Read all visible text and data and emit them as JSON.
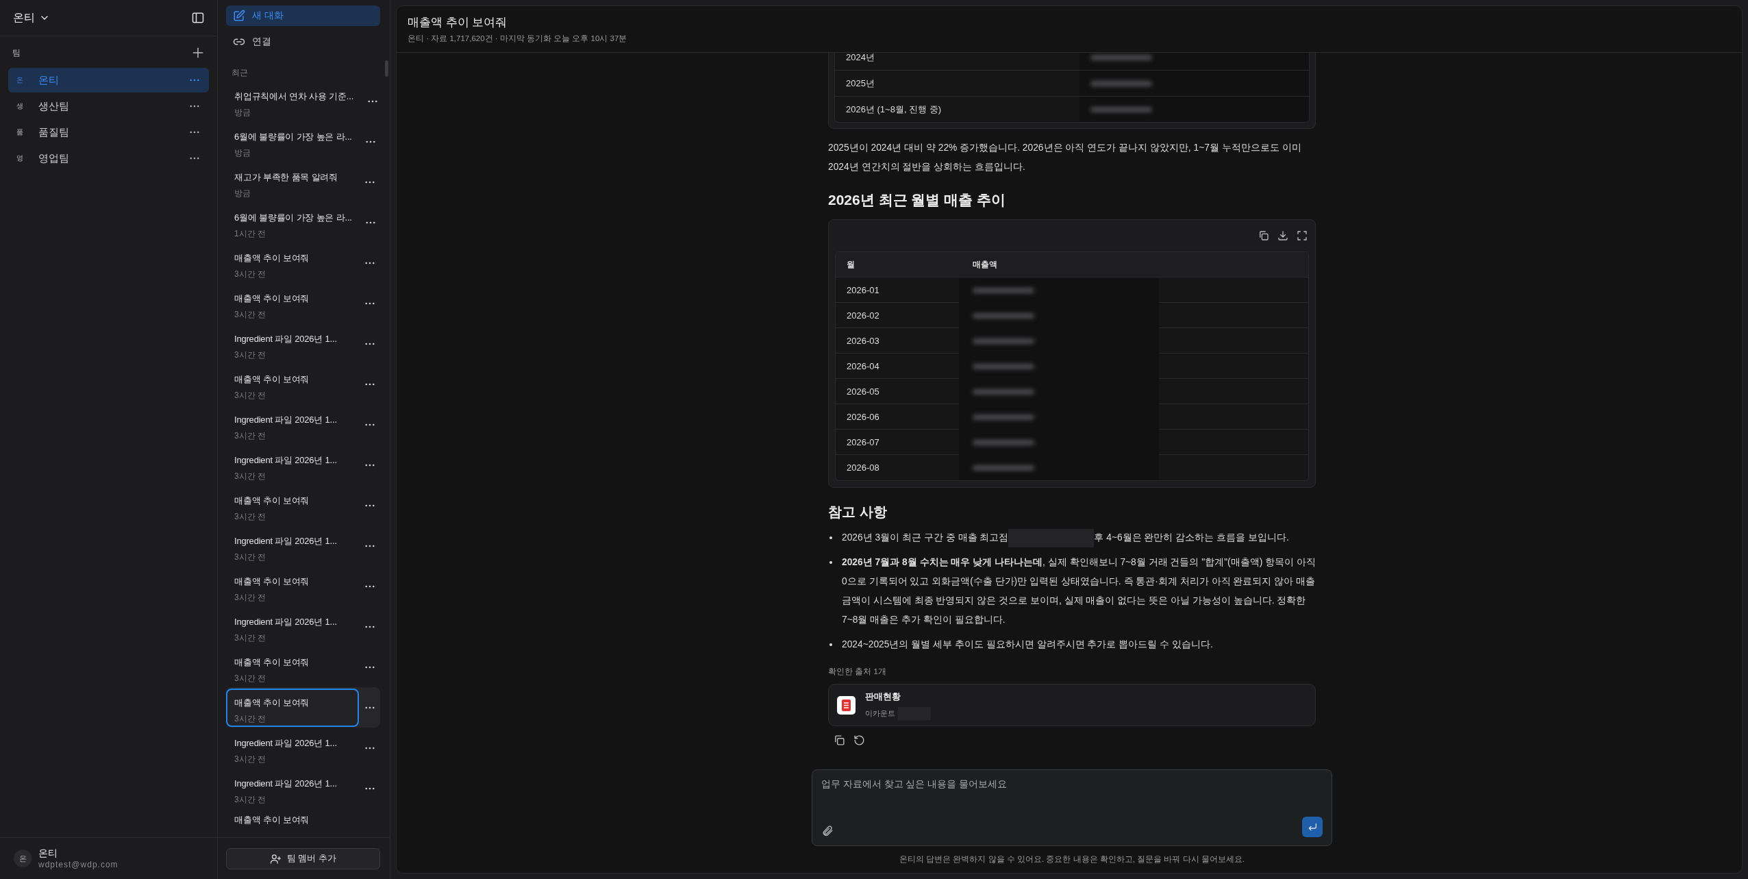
{
  "sidebar": {
    "workspace": "온티",
    "section_label": "팀",
    "teams": [
      {
        "initial": "온",
        "name": "온티",
        "selected": true
      },
      {
        "initial": "생",
        "name": "생산팀",
        "selected": false
      },
      {
        "initial": "품",
        "name": "품질팀",
        "selected": false
      },
      {
        "initial": "영",
        "name": "영업팀",
        "selected": false
      }
    ],
    "user": {
      "initial": "온",
      "name": "온티",
      "email": "wdptest@wdp.com"
    }
  },
  "conversations": {
    "new_chat": "새 대화",
    "connect": "연결",
    "section_label": "최근",
    "items": [
      {
        "title": "취업규칙에서 연차 사용 기준...",
        "time": "방금",
        "selected": false
      },
      {
        "title": "6월에 불량률이 가장 높은 라...",
        "time": "방금",
        "selected": false
      },
      {
        "title": "재고가 부족한 품목 알려줘",
        "time": "방금",
        "selected": false
      },
      {
        "title": "6월에 불량률이 가장 높은 라...",
        "time": "1시간 전",
        "selected": false
      },
      {
        "title": "매출액 추이 보여줘",
        "time": "3시간 전",
        "selected": false
      },
      {
        "title": "매출액 추이 보여줘",
        "time": "3시간 전",
        "selected": false
      },
      {
        "title": "Ingredient 파일 2026년 1...",
        "time": "3시간 전",
        "selected": false
      },
      {
        "title": "매출액 추이 보여줘",
        "time": "3시간 전",
        "selected": false
      },
      {
        "title": "Ingredient 파일 2026년 1...",
        "time": "3시간 전",
        "selected": false
      },
      {
        "title": "Ingredient 파일 2026년 1...",
        "time": "3시간 전",
        "selected": false
      },
      {
        "title": "매출액 추이 보여줘",
        "time": "3시간 전",
        "selected": false
      },
      {
        "title": "Ingredient 파일 2026년 1...",
        "time": "3시간 전",
        "selected": false
      },
      {
        "title": "매출액 추이 보여줘",
        "time": "3시간 전",
        "selected": false
      },
      {
        "title": "Ingredient 파일 2026년 1...",
        "time": "3시간 전",
        "selected": false
      },
      {
        "title": "매출액 추이 보여줘",
        "time": "3시간 전",
        "selected": false
      },
      {
        "title": "매출액 추이 보여줘",
        "time": "3시간 전",
        "selected": true
      },
      {
        "title": "Ingredient 파일 2026년 1...",
        "time": "3시간 전",
        "selected": false
      },
      {
        "title": "Ingredient 파일 2026년 1...",
        "time": "3시간 전",
        "selected": false
      },
      {
        "title": "매출액 추이 보여줘"
      }
    ],
    "add_member": "팀 멤버 추가"
  },
  "chat": {
    "title": "매출액 추이 보여줘",
    "subtitle": "온티 · 자료 1,717,620건 · 마지막 동기화 오늘 오후 10시 37분",
    "yearly_table": {
      "rows": [
        "2024년",
        "2025년",
        "2026년 (1~8월, 진행 중)"
      ]
    },
    "summary": "2025년이 2024년 대비 약 22% 증가했습니다. 2026년은 아직 연도가 끝나지 않았지만, 1~7월 누적만으로도 이미 2024년 연간치의 절반을 상회하는 흐름입니다.",
    "monthly_heading": "2026년 최근 월별 매출 추이",
    "monthly_table": {
      "columns": [
        "월",
        "매출액"
      ],
      "rows": [
        "2026-01",
        "2026-02",
        "2026-03",
        "2026-04",
        "2026-05",
        "2026-06",
        "2026-07",
        "2026-08"
      ]
    },
    "notes_heading": "참고 사항",
    "notes": [
      {
        "parts": [
          "2026년 3월이 최근 구간 중 매출 최고점",
          "후 4~6월은 완만히 감소하는 흐름을 보입니다."
        ]
      },
      {
        "parts": [
          "**2026년 7월과 8월 수치는 매우 낮게 나타나는데**, 실제 확인해보니 7~8월 거래 건들의 \"합계\"(매출액) 항목이 아직 0으로 기록되어 있고 외화금액(수출 단가)만 입력된 상태였습니다. 즉 통관·회계 처리가 아직 완료되지 않아 매출 금액이 시스템에 최종 반영되지 않은 것으로 보이며, 실제 매출이 없다는 뜻은 아닐 가능성이 높습니다. 정확한 7~8월 매출은 추가 확인이 필요합니다."
        ]
      },
      {
        "parts": [
          "2024~2025년의 월별 세부 추이도 필요하시면 알려주시면 추가로 뽑아드릴 수 있습니다."
        ]
      }
    ],
    "sources_label": "확인한 출처 1개",
    "sources": [
      {
        "name": "판매현황",
        "detail": "이카운트"
      }
    ],
    "composer": {
      "placeholder": "업무 자료에서 찾고 싶은 내용을 물어보세요",
      "disclaimer": "온티의 답변은 완벽하지 않을 수 있어요. 중요한 내용은 확인하고, 질문을 바꿔 다시 물어보세요."
    }
  }
}
